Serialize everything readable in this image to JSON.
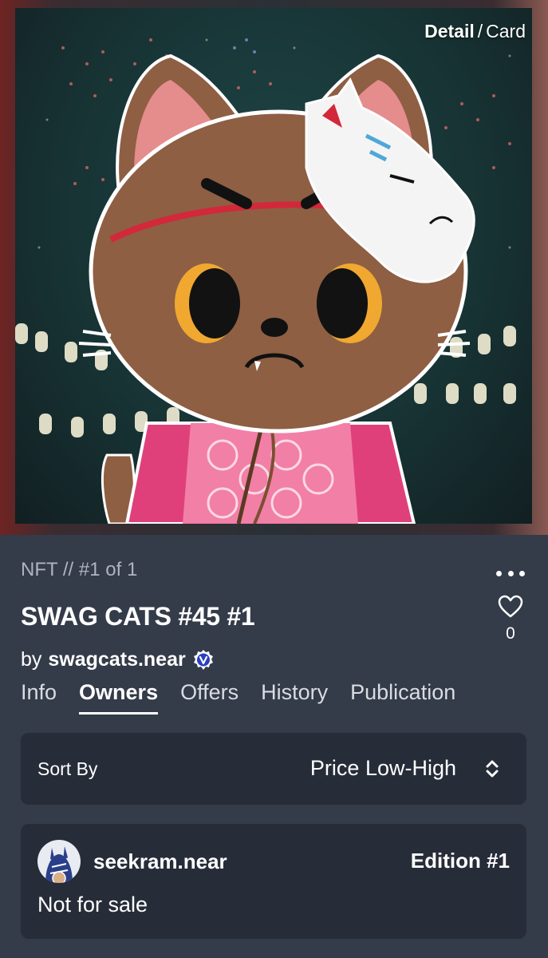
{
  "view_toggle": {
    "detail": "Detail",
    "separator": "/",
    "card": "Card"
  },
  "nft": {
    "meta": "NFT // #1 of 1",
    "title": "SWAG CATS #45 #1",
    "by": "by",
    "creator": "swagcats.near",
    "likes": "0"
  },
  "tabs": [
    {
      "label": "Info"
    },
    {
      "label": "Owners",
      "active": true
    },
    {
      "label": "Offers"
    },
    {
      "label": "History"
    },
    {
      "label": "Publication"
    }
  ],
  "sort": {
    "label": "Sort By",
    "value": "Price Low-High"
  },
  "owner": {
    "name": "seekram.near",
    "edition": "Edition #1",
    "status": "Not for sale"
  },
  "icons": {
    "more": "more-horizontal-icon",
    "like": "heart-icon",
    "verified": "verified-badge-icon",
    "sort": "chevron-up-down-icon"
  },
  "colors": {
    "background": "#343b49",
    "card": "#262c38",
    "muted": "#aeb4bf"
  }
}
